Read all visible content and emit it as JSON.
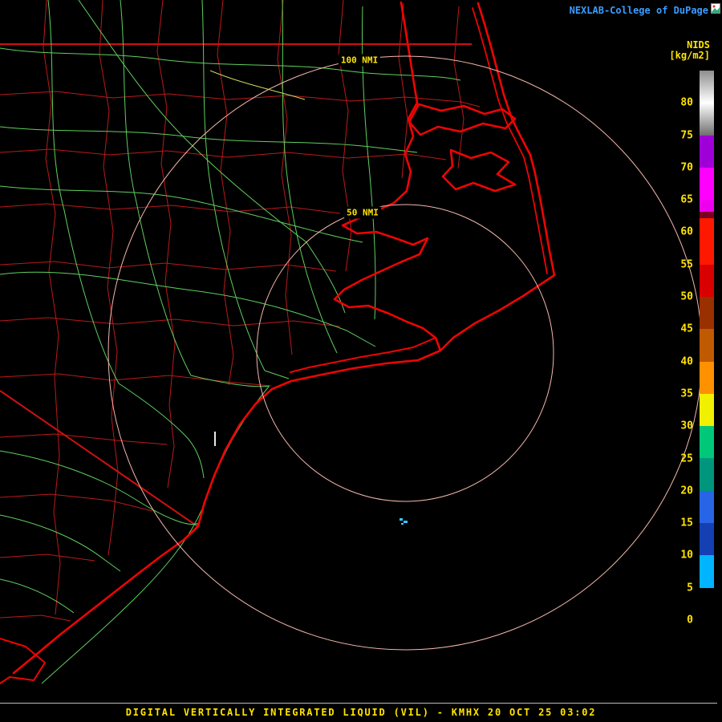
{
  "header": {
    "title": "NEXLAB-College of DuPage",
    "title_color": "#3c9dff"
  },
  "legend": {
    "product": "NIDS",
    "units": "[kg/m2]",
    "text_color": "#ffe400",
    "tick_labels": [
      "80",
      "75",
      "70",
      "65",
      "60",
      "55",
      "50",
      "45",
      "40",
      "35",
      "30",
      "25",
      "20",
      "15",
      "10",
      "5",
      "0"
    ],
    "band_colors": [
      "linear-gradient(to bottom,#8e8e8e,#ffffff)",
      "linear-gradient(to bottom,#ffffff,#6f6f6f)",
      "#a000d8",
      "#ff00ff",
      "linear-gradient(to bottom,#ee00ee 0%,#ee00ee 38%,#7a0024 38%,#7a0024 58%,#ff1800 58%,#ff1800 100%)",
      "#ff1800",
      "#d80000",
      "#993000",
      "#c05a00",
      "#ff9000",
      "#f0f000",
      "#00c878",
      "#00967d",
      "#2864e6",
      "#1440b4",
      "#00b4ff",
      "#000000"
    ]
  },
  "rings": {
    "outer_label": "100 NMI",
    "inner_label": "50 NMI",
    "color": "#f4b8ac",
    "label_color": "#ffe400"
  },
  "map": {
    "county_color": "#bb1a1a",
    "state_border_color": "#d01010",
    "coast_color": "#ee0404",
    "road_color": "#5fcf5f",
    "road_alt_color": "#c8d860",
    "marker_color": "#e8e8e8",
    "echo_color": "#38c8ff"
  },
  "footer": {
    "caption": "DIGITAL VERTICALLY INTEGRATED LIQUID (VIL) - KMHX 20 OCT 25 03:02",
    "caption_color": "#ffe400"
  }
}
